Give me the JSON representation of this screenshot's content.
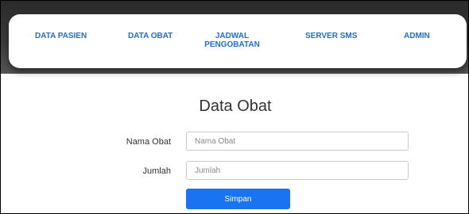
{
  "navbar": {
    "items": [
      {
        "label": "DATA PASIEN"
      },
      {
        "label": "DATA OBAT"
      },
      {
        "label": "JADWAL PENGOBATAN"
      },
      {
        "label": "SERVER SMS"
      },
      {
        "label": "ADMIN"
      }
    ]
  },
  "form": {
    "title": "Data Obat",
    "fields": [
      {
        "label": "Nama Obat",
        "placeholder": "Nama Obat",
        "value": ""
      },
      {
        "label": "Jumlah",
        "placeholder": "Jumlah",
        "value": ""
      }
    ],
    "submit_label": "Simpan"
  },
  "colors": {
    "nav_text": "#1f6fd4",
    "button": "#1a74f2",
    "header_background": "#333333"
  }
}
